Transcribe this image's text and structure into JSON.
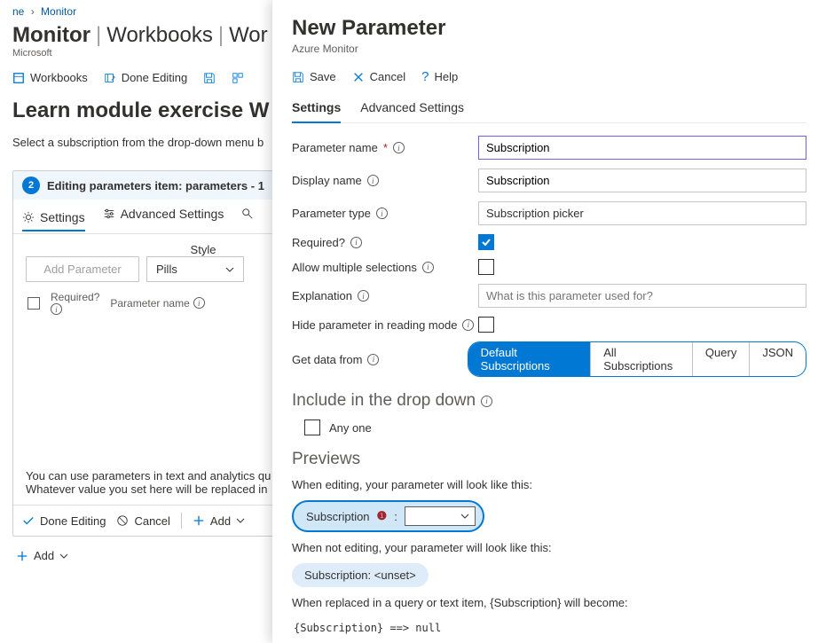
{
  "breadcrumb": {
    "item1": "ne",
    "item2": "Monitor"
  },
  "header": {
    "title_strong": "Monitor",
    "title_rest1": "Workbooks",
    "title_rest2": "Wor",
    "org": "Microsoft"
  },
  "toolbar": {
    "workbooks": "Workbooks",
    "done": "Done Editing"
  },
  "module": {
    "title": "Learn module exercise W",
    "instruction": "Select a subscription from the drop-down menu b"
  },
  "step": {
    "num": "2",
    "title": "Editing parameters item: parameters - 1",
    "tabs": {
      "settings": "Settings",
      "advanced": "Advanced Settings"
    },
    "style_label": "Style",
    "add_param": "Add Parameter",
    "style_value": "Pills",
    "cols": {
      "required": "Required?",
      "pname": "Parameter name"
    },
    "hint1": "You can use parameters in text and analytics qu",
    "hint2": "Whatever value you set here will be replaced in"
  },
  "footer": {
    "done": "Done Editing",
    "cancel": "Cancel",
    "add": "Add"
  },
  "root_add": "Add",
  "panel": {
    "title": "New Parameter",
    "sub": "Azure Monitor",
    "actions": {
      "save": "Save",
      "cancel": "Cancel",
      "help": "Help"
    },
    "tabs": {
      "settings": "Settings",
      "advanced": "Advanced Settings"
    },
    "form": {
      "pname_label": "Parameter name",
      "pname_value": "Subscription",
      "dname_label": "Display name",
      "dname_value": "Subscription",
      "ptype_label": "Parameter type",
      "ptype_value": "Subscription picker",
      "required_label": "Required?",
      "multi_label": "Allow multiple selections",
      "expl_label": "Explanation",
      "expl_placeholder": "What is this parameter used for?",
      "hide_label": "Hide parameter in reading mode",
      "data_label": "Get data from",
      "pills": {
        "default": "Default Subscriptions",
        "all": "All Subscriptions",
        "query": "Query",
        "json": "JSON"
      }
    },
    "include": {
      "heading": "Include in the drop down",
      "anyone": "Any one"
    },
    "previews": {
      "heading": "Previews",
      "editing_text": "When editing, your parameter will look like this:",
      "pill_label": "Subscription",
      "not_editing_text": "When not editing, your parameter will look like this:",
      "unset": "Subscription: <unset>",
      "replaced_text": "When replaced in a query or text item, {Subscription} will become:",
      "mono": "{Subscription} ==>  null"
    }
  }
}
